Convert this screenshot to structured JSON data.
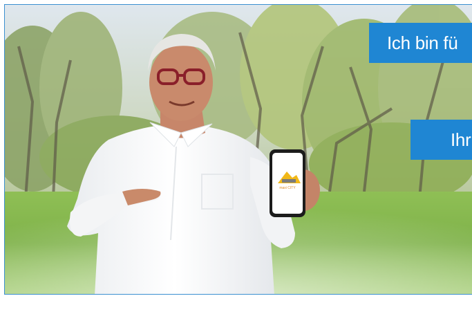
{
  "banners": {
    "line1": "Ich bin fü",
    "line2": "Ihr"
  },
  "phone_screen": {
    "logo_text": "maxi CITY"
  },
  "colors": {
    "banner_blue": "#1f86d3",
    "frame_border": "#3a8fd0",
    "grass": "#7fb24a",
    "sky": "#e8eef2"
  }
}
